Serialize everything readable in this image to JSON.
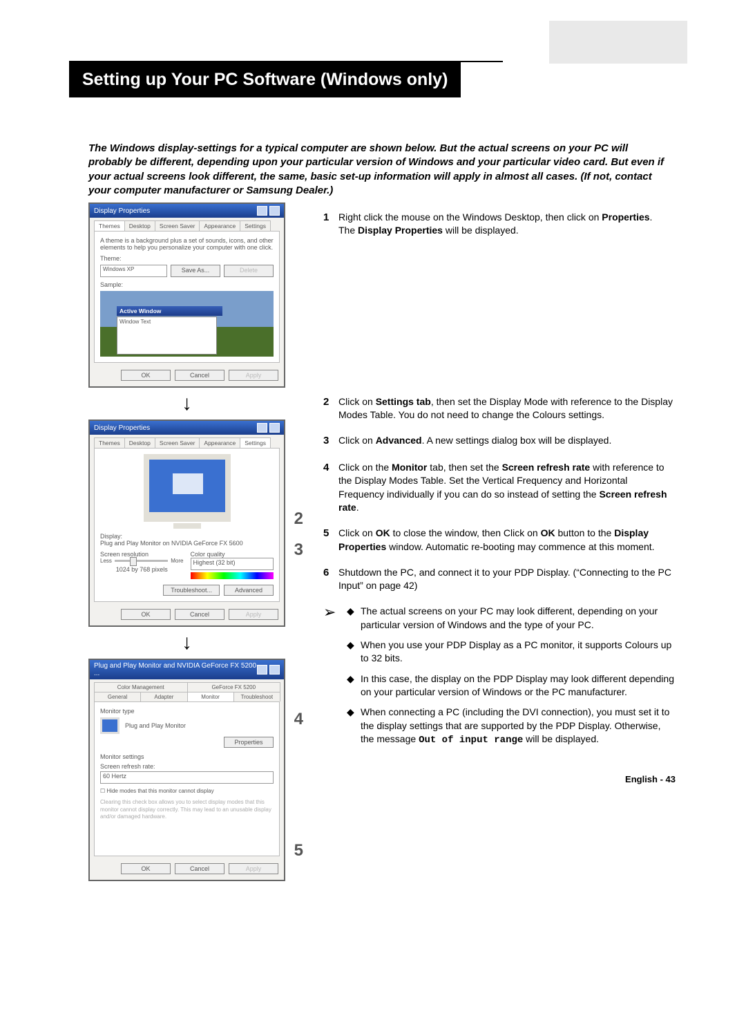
{
  "title": "Setting up Your PC Software (Windows only)",
  "intro": "The Windows display-settings for a typical computer are shown below. But the actual screens on your PC will probably be different, depending upon your particular version of Windows and your particular video card. But even if your actual screens look different, the same, basic set-up information will apply in almost all cases. (If not, contact your computer manufacturer or Samsung Dealer.)",
  "dlg1": {
    "title": "Display Properties",
    "tabs": [
      "Themes",
      "Desktop",
      "Screen Saver",
      "Appearance",
      "Settings"
    ],
    "desc": "A theme is a background plus a set of sounds, icons, and other elements to help you personalize your computer with one click.",
    "theme_label": "Theme:",
    "theme_value": "Windows XP",
    "save_as": "Save As...",
    "delete": "Delete",
    "sample_label": "Sample:",
    "active_window": "Active Window",
    "window_text": "Window Text",
    "ok": "OK",
    "cancel": "Cancel",
    "apply": "Apply"
  },
  "dlg2": {
    "title": "Display Properties",
    "tabs": [
      "Themes",
      "Desktop",
      "Screen Saver",
      "Appearance",
      "Settings"
    ],
    "display_label": "Display:",
    "display_value": "Plug and Play Monitor on NVIDIA GeForce FX 5600",
    "res_label": "Screen resolution",
    "less": "Less",
    "more": "More",
    "res_value": "1024 by 768 pixels",
    "cq_label": "Color quality",
    "cq_value": "Highest (32 bit)",
    "troubleshoot": "Troubleshoot...",
    "advanced": "Advanced",
    "ok": "OK",
    "cancel": "Cancel",
    "apply": "Apply"
  },
  "dlg3": {
    "title": "Plug and Play Monitor and NVIDIA GeForce FX 5200 ...",
    "tabs_row1": [
      "Color Management",
      "GeForce FX 5200"
    ],
    "tabs_row2": [
      "General",
      "Adapter",
      "Monitor",
      "Troubleshoot"
    ],
    "mtype": "Monitor type",
    "mname": "Plug and Play Monitor",
    "properties": "Properties",
    "msettings": "Monitor settings",
    "srr": "Screen refresh rate:",
    "srr_value": "60 Hertz",
    "hide": "Hide modes that this monitor cannot display",
    "hide_desc": "Clearing this check box allows you to select display modes that this monitor cannot display correctly. This may lead to an unusable display and/or damaged hardware.",
    "ok": "OK",
    "cancel": "Cancel",
    "apply": "Apply"
  },
  "callouts": {
    "c2": "2",
    "c3": "3",
    "c4": "4",
    "c5": "5"
  },
  "steps": {
    "s1a": "Right click the mouse on the Windows Desktop, then click on ",
    "s1b": "Properties",
    "s1c": ".",
    "s1d": "The ",
    "s1e": "Display Properties",
    "s1f": " will be displayed.",
    "s2a": "Click on ",
    "s2b": "Settings tab",
    "s2c": ", then set the Display Mode with reference to the Display Modes Table. You do not need to change the Colours settings.",
    "s3a": "Click on ",
    "s3b": "Advanced",
    "s3c": ". A new settings dialog box will be displayed.",
    "s4a": "Click on the ",
    "s4b": "Monitor",
    "s4c": " tab, then set the ",
    "s4d": "Screen refresh rate",
    "s4e": " with reference to the Display Modes Table. Set the Vertical Frequency and Horizontal Frequency individually if you can do so instead of setting the ",
    "s4f": "Screen refresh rate",
    "s4g": ".",
    "s5a": "Click on ",
    "s5b": "OK",
    "s5c": " to close the window, then Click on ",
    "s5d": "OK",
    "s5e": " button to the ",
    "s5f": "Display Properties",
    "s5g": " window. Automatic re-booting may commence at this moment.",
    "s6a": "Shutdown the PC, and connect it to your PDP Display. (“Connecting to the PC Input” on page 42)"
  },
  "notes": {
    "n1": "The actual screens on your PC may look different, depending on your particular version of Windows and the type of your PC.",
    "n2": "When you use your PDP Display as a PC monitor, it supports Colours up to 32 bits.",
    "n3": "In this case, the display on the PDP Display may look different depending on your particular version of Windows or the PC manufacturer.",
    "n4a": "When connecting a PC (including the DVI connection), you must set it to the display settings that are supported by the PDP Display. Otherwise, the message ",
    "n4b": "Out of input range",
    "n4c": " will be displayed."
  },
  "footer": "English - 43"
}
